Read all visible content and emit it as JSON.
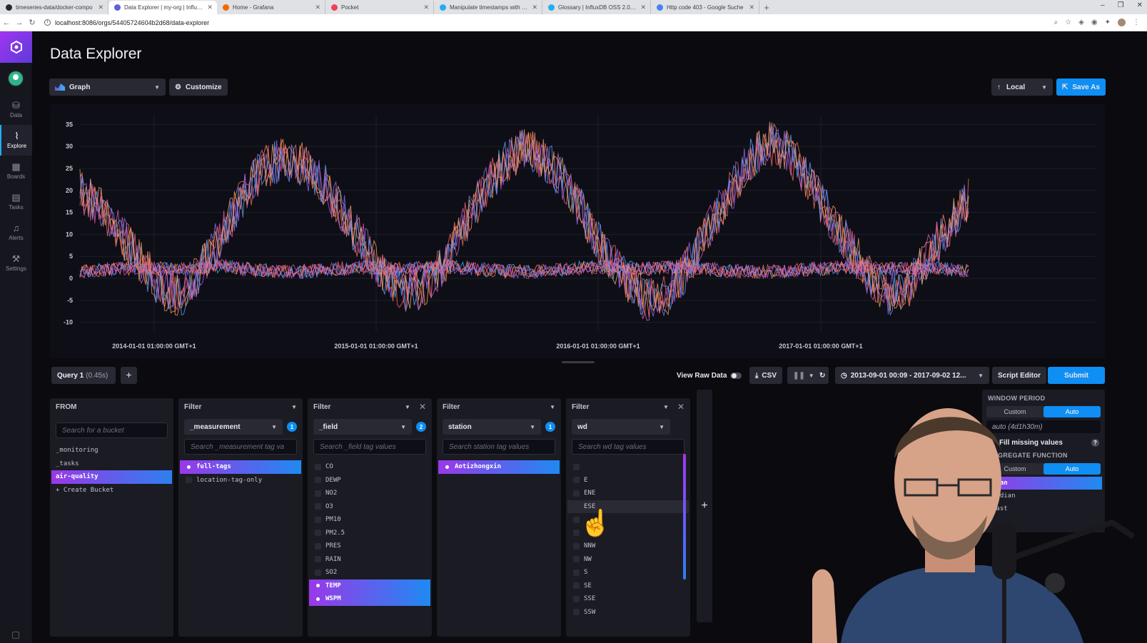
{
  "browser": {
    "tabs": [
      {
        "title": "timeseries-data/docker-compo",
        "favicon_color": "#24292e"
      },
      {
        "title": "Data Explorer | my-org | InfluxDB",
        "favicon_color": "#5e60e0",
        "active": true
      },
      {
        "title": "Home - Grafana",
        "favicon_color": "#f46800"
      },
      {
        "title": "Pocket",
        "favicon_color": "#ef4056"
      },
      {
        "title": "Manipulate timestamps with Flu",
        "favicon_color": "#22adf6"
      },
      {
        "title": "Glossary | InfluxDB OSS 2.0 Docu",
        "favicon_color": "#22adf6"
      },
      {
        "title": "Http code 403 - Google Suche",
        "favicon_color": "#4285f4"
      }
    ],
    "url": "localhost:8086/orgs/54405724604b2d68/data-explorer"
  },
  "nav": {
    "items": [
      {
        "label": "Data",
        "icon": "database-icon"
      },
      {
        "label": "Explore",
        "icon": "graph-line-icon",
        "active": true
      },
      {
        "label": "Boards",
        "icon": "dashboard-grid-icon"
      },
      {
        "label": "Tasks",
        "icon": "calendar-icon"
      },
      {
        "label": "Alerts",
        "icon": "bell-icon"
      },
      {
        "label": "Settings",
        "icon": "wrench-icon"
      }
    ]
  },
  "page": {
    "title": "Data Explorer"
  },
  "toolbar": {
    "vis_type": "Graph",
    "customize": "Customize",
    "timezone": "Local",
    "save_as": "Save As"
  },
  "chart_data": {
    "type": "line",
    "y_ticks": [
      "35",
      "30",
      "25",
      "20",
      "15",
      "10",
      "5",
      "0",
      "-5",
      "-10"
    ],
    "ylim": [
      -12,
      37
    ],
    "x_ticks": [
      "2014-01-01 01:00:00 GMT+1",
      "2015-01-01 01:00:00 GMT+1",
      "2016-01-01 01:00:00 GMT+1",
      "2017-01-01 01:00:00 GMT+1"
    ],
    "grid": true,
    "series_colors": [
      "#f36b5c",
      "#ff8a65",
      "#d65bb4",
      "#8e6cf0",
      "#5e9ff5",
      "#f0a060",
      "#e0567a",
      "#3fb6f5"
    ],
    "series": [
      {
        "kind": "TEMP",
        "x_start": "2013-09-01",
        "x_end": "2017-09-01",
        "values": [
          20,
          16,
          10,
          4,
          -2,
          -4,
          2,
          10,
          18,
          25,
          27,
          26,
          22,
          15,
          8,
          1,
          -3,
          -2,
          3,
          12,
          20,
          26,
          30,
          27,
          22,
          14,
          6,
          0,
          -5,
          -4,
          2,
          10,
          18,
          26,
          31,
          29,
          23,
          15,
          8,
          1,
          -4,
          -2,
          5,
          12,
          18
        ]
      },
      {
        "kind": "WSPM",
        "x_start": "2013-09-01",
        "x_end": "2017-09-01",
        "values": [
          1.5,
          2,
          2.2,
          2.5,
          2.2,
          2,
          2.4,
          2.8,
          2.2,
          1.8,
          1.6,
          1.5,
          1.8,
          2.2,
          2.5,
          2.4,
          2.2,
          2.3,
          2.6,
          2.4,
          2,
          1.7,
          1.5,
          1.6,
          2,
          2.4,
          2.6,
          2.4,
          2.2,
          2.5,
          2.6,
          2.3,
          1.8,
          1.6,
          1.5,
          1.7,
          2.1,
          2.3,
          2.5,
          2.4,
          2.2,
          2.4,
          2.4,
          2.1,
          1.9
        ]
      }
    ]
  },
  "query_bar": {
    "query_label": "Query 1",
    "query_time": "(0.45s)",
    "view_raw": "View Raw Data",
    "csv": "CSV",
    "time_range": "2013-09-01 00:09 - 2017-09-02 12...",
    "script_editor": "Script Editor",
    "submit": "Submit"
  },
  "builder": {
    "from": {
      "header": "FROM",
      "search_placeholder": "Search for a bucket",
      "buckets": [
        "_monitoring",
        "_tasks",
        "air-quality"
      ],
      "selected": "air-quality",
      "create": "+ Create Bucket"
    },
    "filters": [
      {
        "header": "Filter",
        "key": "_measurement",
        "count": "1",
        "search_placeholder": "Search _measurement tag va",
        "values": [
          "full-tags",
          "location-tag-only"
        ],
        "selected": [
          "full-tags"
        ],
        "closable": false
      },
      {
        "header": "Filter",
        "key": "_field",
        "count": "2",
        "search_placeholder": "Search _field tag values",
        "values": [
          "CO",
          "DEWP",
          "NO2",
          "O3",
          "PM10",
          "PM2.5",
          "PRES",
          "RAIN",
          "SO2",
          "TEMP",
          "WSPM"
        ],
        "selected": [
          "TEMP",
          "WSPM"
        ],
        "closable": true
      },
      {
        "header": "Filter",
        "key": "station",
        "count": "1",
        "search_placeholder": "Search station tag values",
        "values": [
          "Aotizhongxin"
        ],
        "selected": [
          "Aotizhongxin"
        ],
        "closable": false
      },
      {
        "header": "Filter",
        "key": "wd",
        "count": "",
        "search_placeholder": "Search wd tag values",
        "values": [
          "",
          "E",
          "ENE",
          "ESE",
          "",
          "",
          "NNW",
          "NW",
          "S",
          "SE",
          "SSE",
          "SSW"
        ],
        "selected": [],
        "hovered": "ESE",
        "closable": true
      }
    ]
  },
  "right_panel": {
    "window_period": "WINDOW PERIOD",
    "custom": "Custom",
    "auto": "Auto",
    "auto_value": "auto (4d1h30m)",
    "fill_missing": "Fill missing values",
    "aggregate": "AGGREGATE FUNCTION",
    "functions": [
      "mean",
      "median",
      "last"
    ],
    "selected_function": "mean"
  }
}
